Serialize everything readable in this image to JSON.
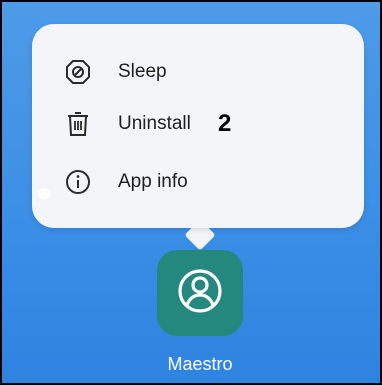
{
  "menu": {
    "items": [
      {
        "label": "Sleep",
        "icon": "sleep-icon"
      },
      {
        "label": "Uninstall",
        "icon": "trash-icon",
        "badge": "2"
      },
      {
        "label": "App info",
        "icon": "info-icon"
      }
    ]
  },
  "app": {
    "name": "Maestro",
    "icon": "user-circle-icon",
    "color": "#25887f"
  },
  "colors": {
    "background": "#3c8fe6",
    "menu_background": "#f3f5f8"
  }
}
